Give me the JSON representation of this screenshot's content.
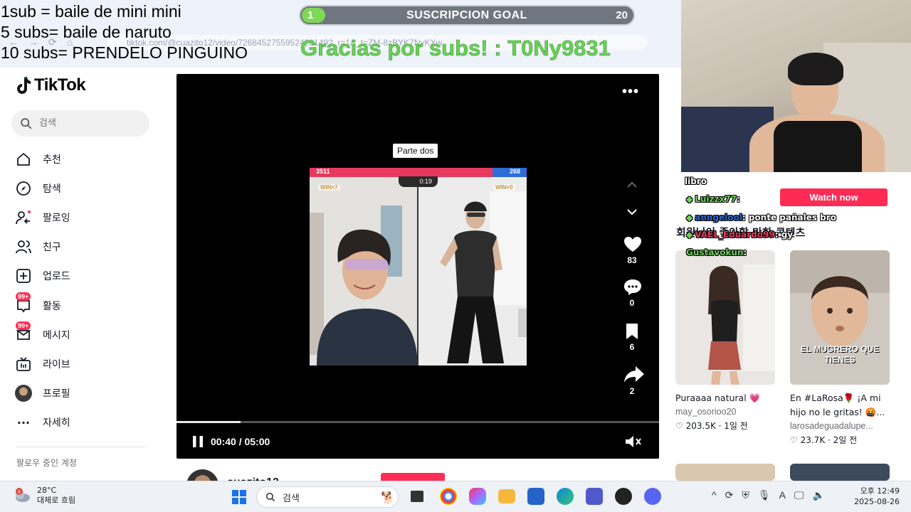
{
  "overlay": {
    "rules": [
      "1sub = baile de mini mini",
      "5 subs= baile de naruto",
      "10 subs= PRENDELO PINGUINO"
    ],
    "goal": {
      "current": "1",
      "title": "SUSCRIPCION GOAL",
      "target": "20",
      "progress_fraction": 0.05
    },
    "thanks": "Gracias por subs! : T0Ny9831"
  },
  "browser": {
    "url": "tiktok.com/@cuazito12/video/7268452755952422149?_r=1&_t=ZM-8zBYK7NyKXw"
  },
  "tiktok": {
    "logo": "TikTok",
    "search_placeholder": "검색",
    "nav": [
      {
        "label": "추천",
        "icon": "home-icon"
      },
      {
        "label": "탐색",
        "icon": "compass-icon"
      },
      {
        "label": "팔로잉",
        "icon": "following-icon"
      },
      {
        "label": "친구",
        "icon": "friends-icon"
      },
      {
        "label": "업로드",
        "icon": "upload-icon"
      },
      {
        "label": "활동",
        "icon": "activity-icon",
        "badge": "99+"
      },
      {
        "label": "메시지",
        "icon": "message-icon",
        "badge": "99+"
      },
      {
        "label": "라이브",
        "icon": "live-icon"
      },
      {
        "label": "프로필",
        "icon": "profile-avatar"
      },
      {
        "label": "자세히",
        "icon": "more-icon"
      }
    ],
    "following_title": "팔로우 중인 계정"
  },
  "video": {
    "caption_tag": "Parte dos",
    "score_left": "3511",
    "score_right": "268",
    "timer": "0:19",
    "win_left": "WIN×7",
    "win_right": "WIN×0",
    "likes": "83",
    "comments": "0",
    "saves": "6",
    "shares": "2",
    "time": "00:40 / 05:00",
    "progress_fraction": 0.133,
    "author": "cuazito12"
  },
  "chat": {
    "first_line": "libro",
    "messages": [
      {
        "user": "Luizzx77",
        "text": ":",
        "color": "#6ed05b"
      },
      {
        "user": "anngelool",
        "text": ": ponte pañales bro",
        "color": "#2a6ad8"
      },
      {
        "user": "VAEL_Eduardo99",
        "text": ": gy",
        "color": "#e04060"
      },
      {
        "user": "Gustavokun",
        "text": ":",
        "color": "#6ed05b"
      }
    ]
  },
  "sidebar_right": {
    "watch_now": "Watch now",
    "heading": "회원님이 좋아할 만한 콘텐츠",
    "cards": [
      {
        "title": "Puraaaa natural 💗",
        "user": "may_osorioo20",
        "likes": "203.5K",
        "age": "1일 전"
      },
      {
        "title": "En #LaRosa🌹 ¡A mi hijo no le gritas! 🤬...",
        "user": "larosadeguadalupe...",
        "likes": "23.7K",
        "age": "2일 전",
        "thumb_caption": "EL MUGRERO QUE TIENES"
      }
    ]
  },
  "taskbar": {
    "weather_temp": "28°C",
    "weather_desc": "대체로 흐림",
    "weather_badge": "6",
    "search": "검색",
    "time": "오후 12:49",
    "date": "2025-08-26"
  }
}
